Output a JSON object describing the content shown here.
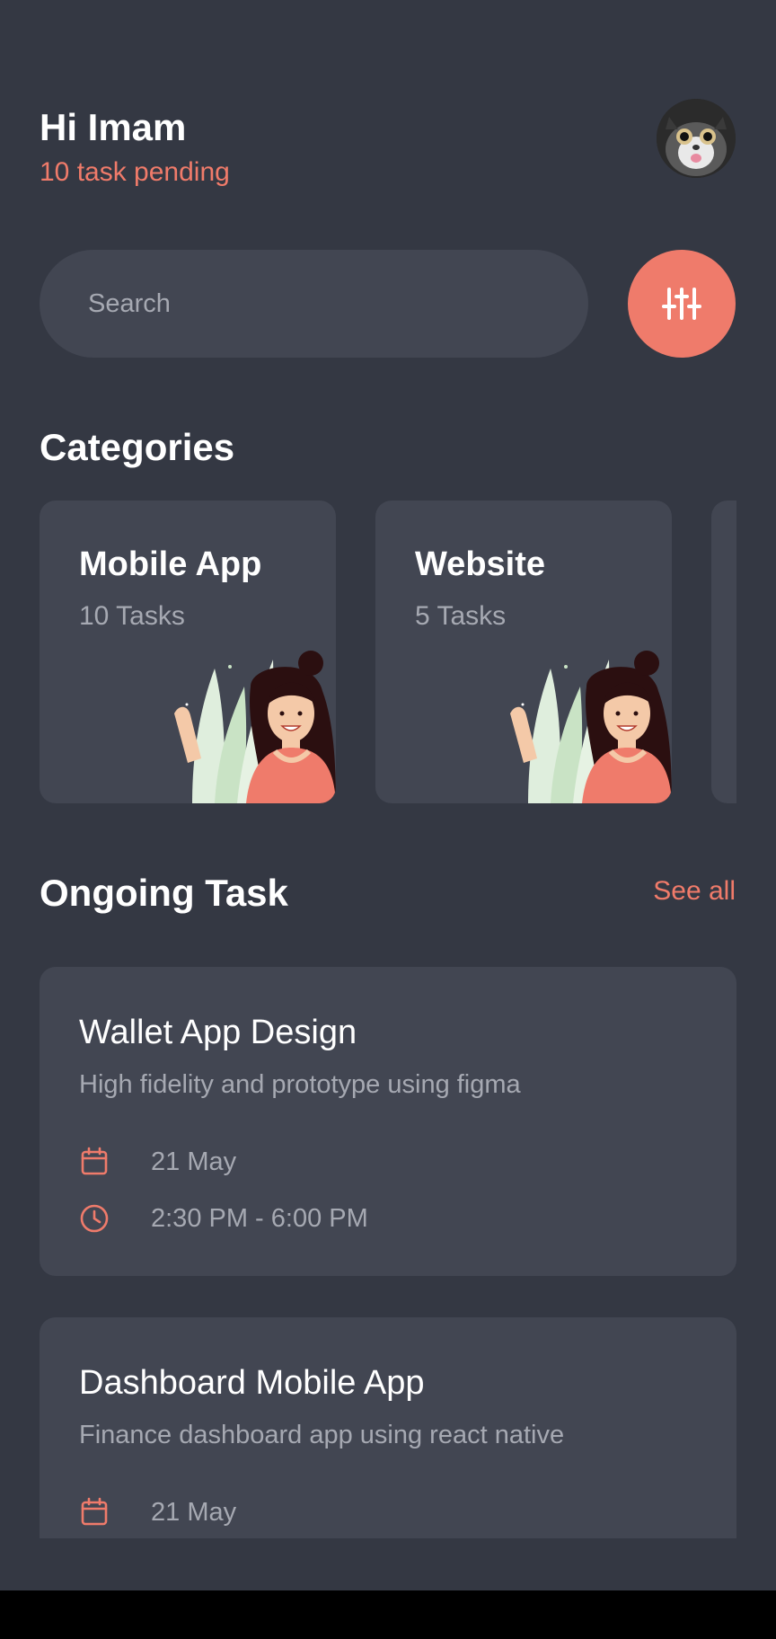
{
  "header": {
    "greeting": "Hi Imam",
    "pending": "10 task pending"
  },
  "search": {
    "placeholder": "Search",
    "value": ""
  },
  "categories": {
    "title": "Categories",
    "items": [
      {
        "title": "Mobile App",
        "count": "10 Tasks"
      },
      {
        "title": "Website",
        "count": "5 Tasks"
      }
    ]
  },
  "ongoing": {
    "title": "Ongoing Task",
    "see_all": "See all",
    "tasks": [
      {
        "title": "Wallet App Design",
        "desc": "High fidelity and prototype using figma",
        "date": "21 May",
        "time": "2:30 PM - 6:00 PM"
      },
      {
        "title": "Dashboard Mobile App",
        "desc": "Finance dashboard app using react native",
        "date": "21 May"
      }
    ]
  },
  "icons": {
    "filter": "sliders-icon",
    "date": "calendar-icon",
    "time": "clock-icon"
  },
  "colors": {
    "background": "#343843",
    "card": "#424652",
    "accent": "#ef7b6b",
    "muted_text": "#a6a9b2"
  }
}
